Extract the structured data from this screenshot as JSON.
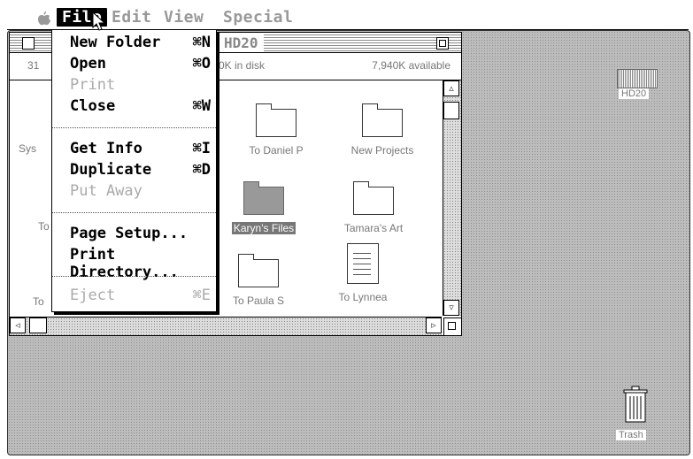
{
  "menubar": {
    "apple_icon": "apple-icon",
    "items": [
      "File",
      "Edit",
      "View",
      "Special"
    ]
  },
  "window": {
    "title": "HD20",
    "info_left": "31",
    "info_middle": "0K in disk",
    "info_right": "7,940K available"
  },
  "icons": [
    {
      "label": "To Daniel P",
      "type": "folder"
    },
    {
      "label": "New Projects",
      "type": "folder"
    },
    {
      "label": "Karyn's Files",
      "type": "folder",
      "selected": true
    },
    {
      "label": "Tamara's Art",
      "type": "folder"
    },
    {
      "label": "To Paula S",
      "type": "folder"
    },
    {
      "label": "To Lynnea",
      "type": "document"
    }
  ],
  "partial_labels": [
    "Sys",
    "To",
    "To"
  ],
  "file_menu": {
    "items": [
      {
        "label": "New Folder",
        "shortcut": "⌘N",
        "enabled": true
      },
      {
        "label": "Open",
        "shortcut": "⌘O",
        "enabled": true
      },
      {
        "label": "Print",
        "shortcut": "",
        "enabled": false
      },
      {
        "label": "Close",
        "shortcut": "⌘W",
        "enabled": true
      },
      {
        "label": "Get Info",
        "shortcut": "⌘I",
        "enabled": true
      },
      {
        "label": "Duplicate",
        "shortcut": "⌘D",
        "enabled": true
      },
      {
        "label": "Put Away",
        "shortcut": "",
        "enabled": false
      },
      {
        "label": "Page Setup...",
        "shortcut": "",
        "enabled": true
      },
      {
        "label": "Print Directory...",
        "shortcut": "",
        "enabled": true
      },
      {
        "label": "Eject",
        "shortcut": "⌘E",
        "enabled": false
      }
    ]
  },
  "desktop": {
    "disk_label": "HD20",
    "trash_label": "Trash"
  }
}
